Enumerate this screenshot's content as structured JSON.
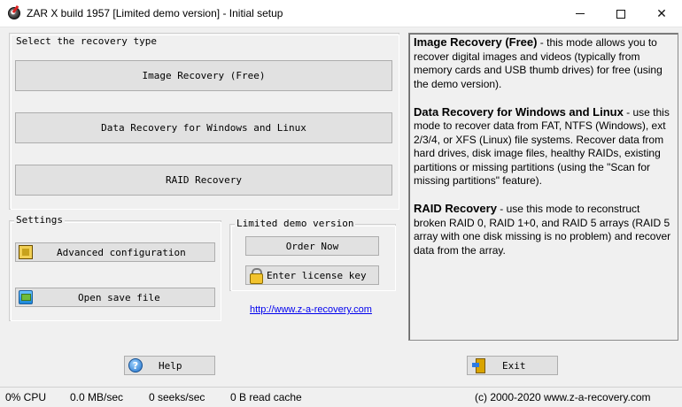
{
  "window": {
    "title": "ZAR X build 1957 [Limited demo version] - Initial setup"
  },
  "recovery_type": {
    "group_title": "Select the recovery type",
    "image_button": "Image Recovery (Free)",
    "data_button": "Data Recovery for Windows and Linux",
    "raid_button": "RAID Recovery"
  },
  "settings": {
    "group_title": "Settings",
    "advanced_button": "Advanced configuration",
    "open_save_button": "Open save file"
  },
  "demo": {
    "group_title": "Limited demo version",
    "order_button": "Order Now",
    "license_button": "Enter license key",
    "link": "http://www.z-a-recovery.com"
  },
  "description": {
    "image_title": "Image Recovery (Free)",
    "image_text": " - this mode allows you to recover digital images and videos (typically from memory cards and USB thumb drives) for free (using the demo version).",
    "data_title": "Data Recovery for Windows and Linux",
    "data_text": " - use this mode to recover data from FAT, NTFS (Windows), ext 2/3/4, or XFS (Linux) file systems. Recover data from hard drives, disk image files, healthy RAIDs, existing partitions or missing partitions (using the \"Scan for missing partitions\" feature).",
    "raid_title": "RAID Recovery",
    "raid_text": " - use this mode to reconstruct broken RAID 0, RAID 1+0, and RAID 5 arrays (RAID 5 array with one disk missing is no problem) and recover data from the array."
  },
  "footer": {
    "help_button": "Help",
    "exit_button": "Exit"
  },
  "status": {
    "cpu": "0% CPU",
    "throughput": "0.0 MB/sec",
    "seeks": "0 seeks/sec",
    "cache": "0 B read cache",
    "copyright": "(c) 2000-2020 www.z-a-recovery.com"
  },
  "icons": {
    "app": "app-disk-icon",
    "advanced": "chip-icon",
    "open_save": "folder-icon",
    "license": "lock-icon",
    "help": "help-icon",
    "exit": "exit-door-icon"
  }
}
